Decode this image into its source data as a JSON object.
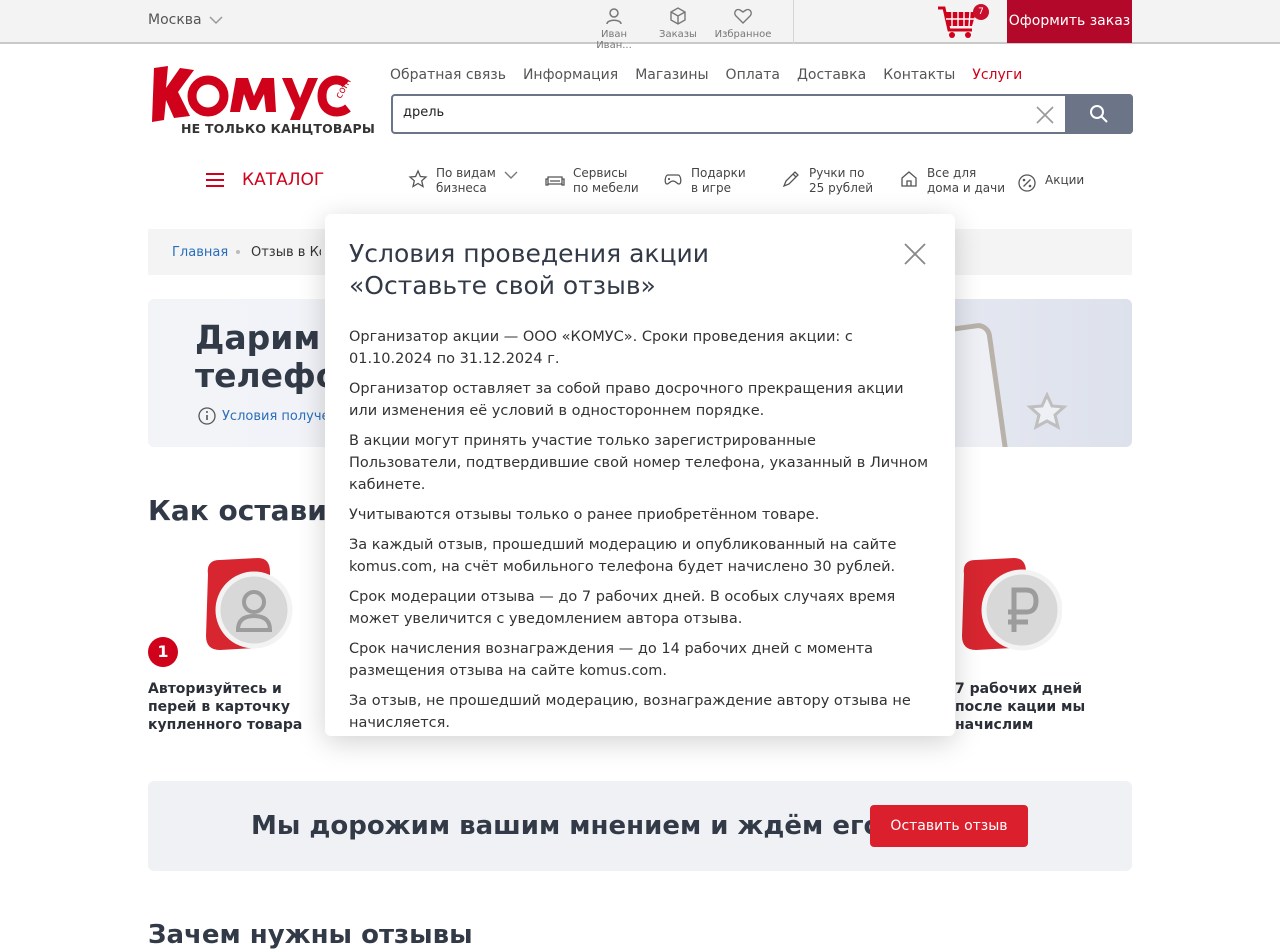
{
  "topbar": {
    "city": "Москва",
    "user_label": "Иван Иван...",
    "orders_label": "Заказы",
    "favorites_label": "Избранное",
    "cart_count": "7",
    "order_button": "Оформить заказ"
  },
  "header": {
    "logo_subtitle": "НЕ ТОЛЬКО КАНЦТОВАРЫ",
    "nav": [
      "Обратная связь",
      "Информация",
      "Магазины",
      "Оплата",
      "Доставка",
      "Контакты",
      "Услуги"
    ],
    "search_value": "дрель"
  },
  "categories": {
    "catalog_label": "КАТАЛОГ",
    "items": [
      {
        "line1": "По видам",
        "line2": "бизнеса",
        "icon": "star-icon"
      },
      {
        "line1": "Сервисы",
        "line2": "по мебели",
        "icon": "sofa-icon"
      },
      {
        "line1": "Подарки",
        "line2": "в игре",
        "icon": "gamepad-icon"
      },
      {
        "line1": "Ручки по",
        "line2": "25 рублей",
        "icon": "pen-icon"
      },
      {
        "line1": "Все для",
        "line2": "дома и дачи",
        "icon": "house-icon"
      },
      {
        "line1": "Акции",
        "line2": "",
        "icon": "percent-icon"
      }
    ]
  },
  "breadcrumb": {
    "home": "Главная",
    "current": "Отзыв в Ко"
  },
  "hero": {
    "title_line1": "Дарим З",
    "title_line2": "телефо",
    "conditions_link": "Условия получе"
  },
  "how": {
    "title": "Как оставить",
    "step1_number": "1",
    "step1_text": "Авторизуйтесь и перей в карточку купленного товара",
    "step3_text": "7 рабочих дней после кации мы начислим"
  },
  "cta": {
    "text": "Мы дорожим вашим мнением и ждём его!",
    "button": "Оставить отзыв"
  },
  "why": {
    "title": "Зачем нужны отзывы"
  },
  "modal": {
    "title_line1": "Условия проведения акции",
    "title_line2": "«Оставьте свой отзыв»",
    "paragraphs": [
      "Организатор акции — ООО «КОМУС». Сроки проведения акции: с 01.10.2024 по 31.12.2024 г.",
      "Организатор оставляет за собой право досрочного прекращения акции или изменения её условий в одностороннем порядке.",
      "В акции могут принять участие только зарегистрированные Пользователи, подтвердившие свой номер телефона, указанный в Личном кабинете.",
      "Учитываются отзывы только о ранее приобретённом товаре.",
      "За каждый отзыв, прошедший модерацию и опубликованный на сайте komus.com, на счёт мобильного телефона будет начислено 30 рублей.",
      "Срок модерации отзыва — до 7 рабочих дней. В особых случаях время может увеличится с уведомлением автора отзыва.",
      "Срок начисления вознаграждения — до 14 рабочих дней с момента размещения отзыва на сайте komus.com.",
      "За отзыв, не прошедший модерацию, вознаграждение автору отзыва не начисляется."
    ]
  },
  "colors": {
    "brand_red": "#d0011b",
    "order_button": "#b3082a",
    "search_button": "#6b7587",
    "link_blue": "#2a6ebb"
  }
}
